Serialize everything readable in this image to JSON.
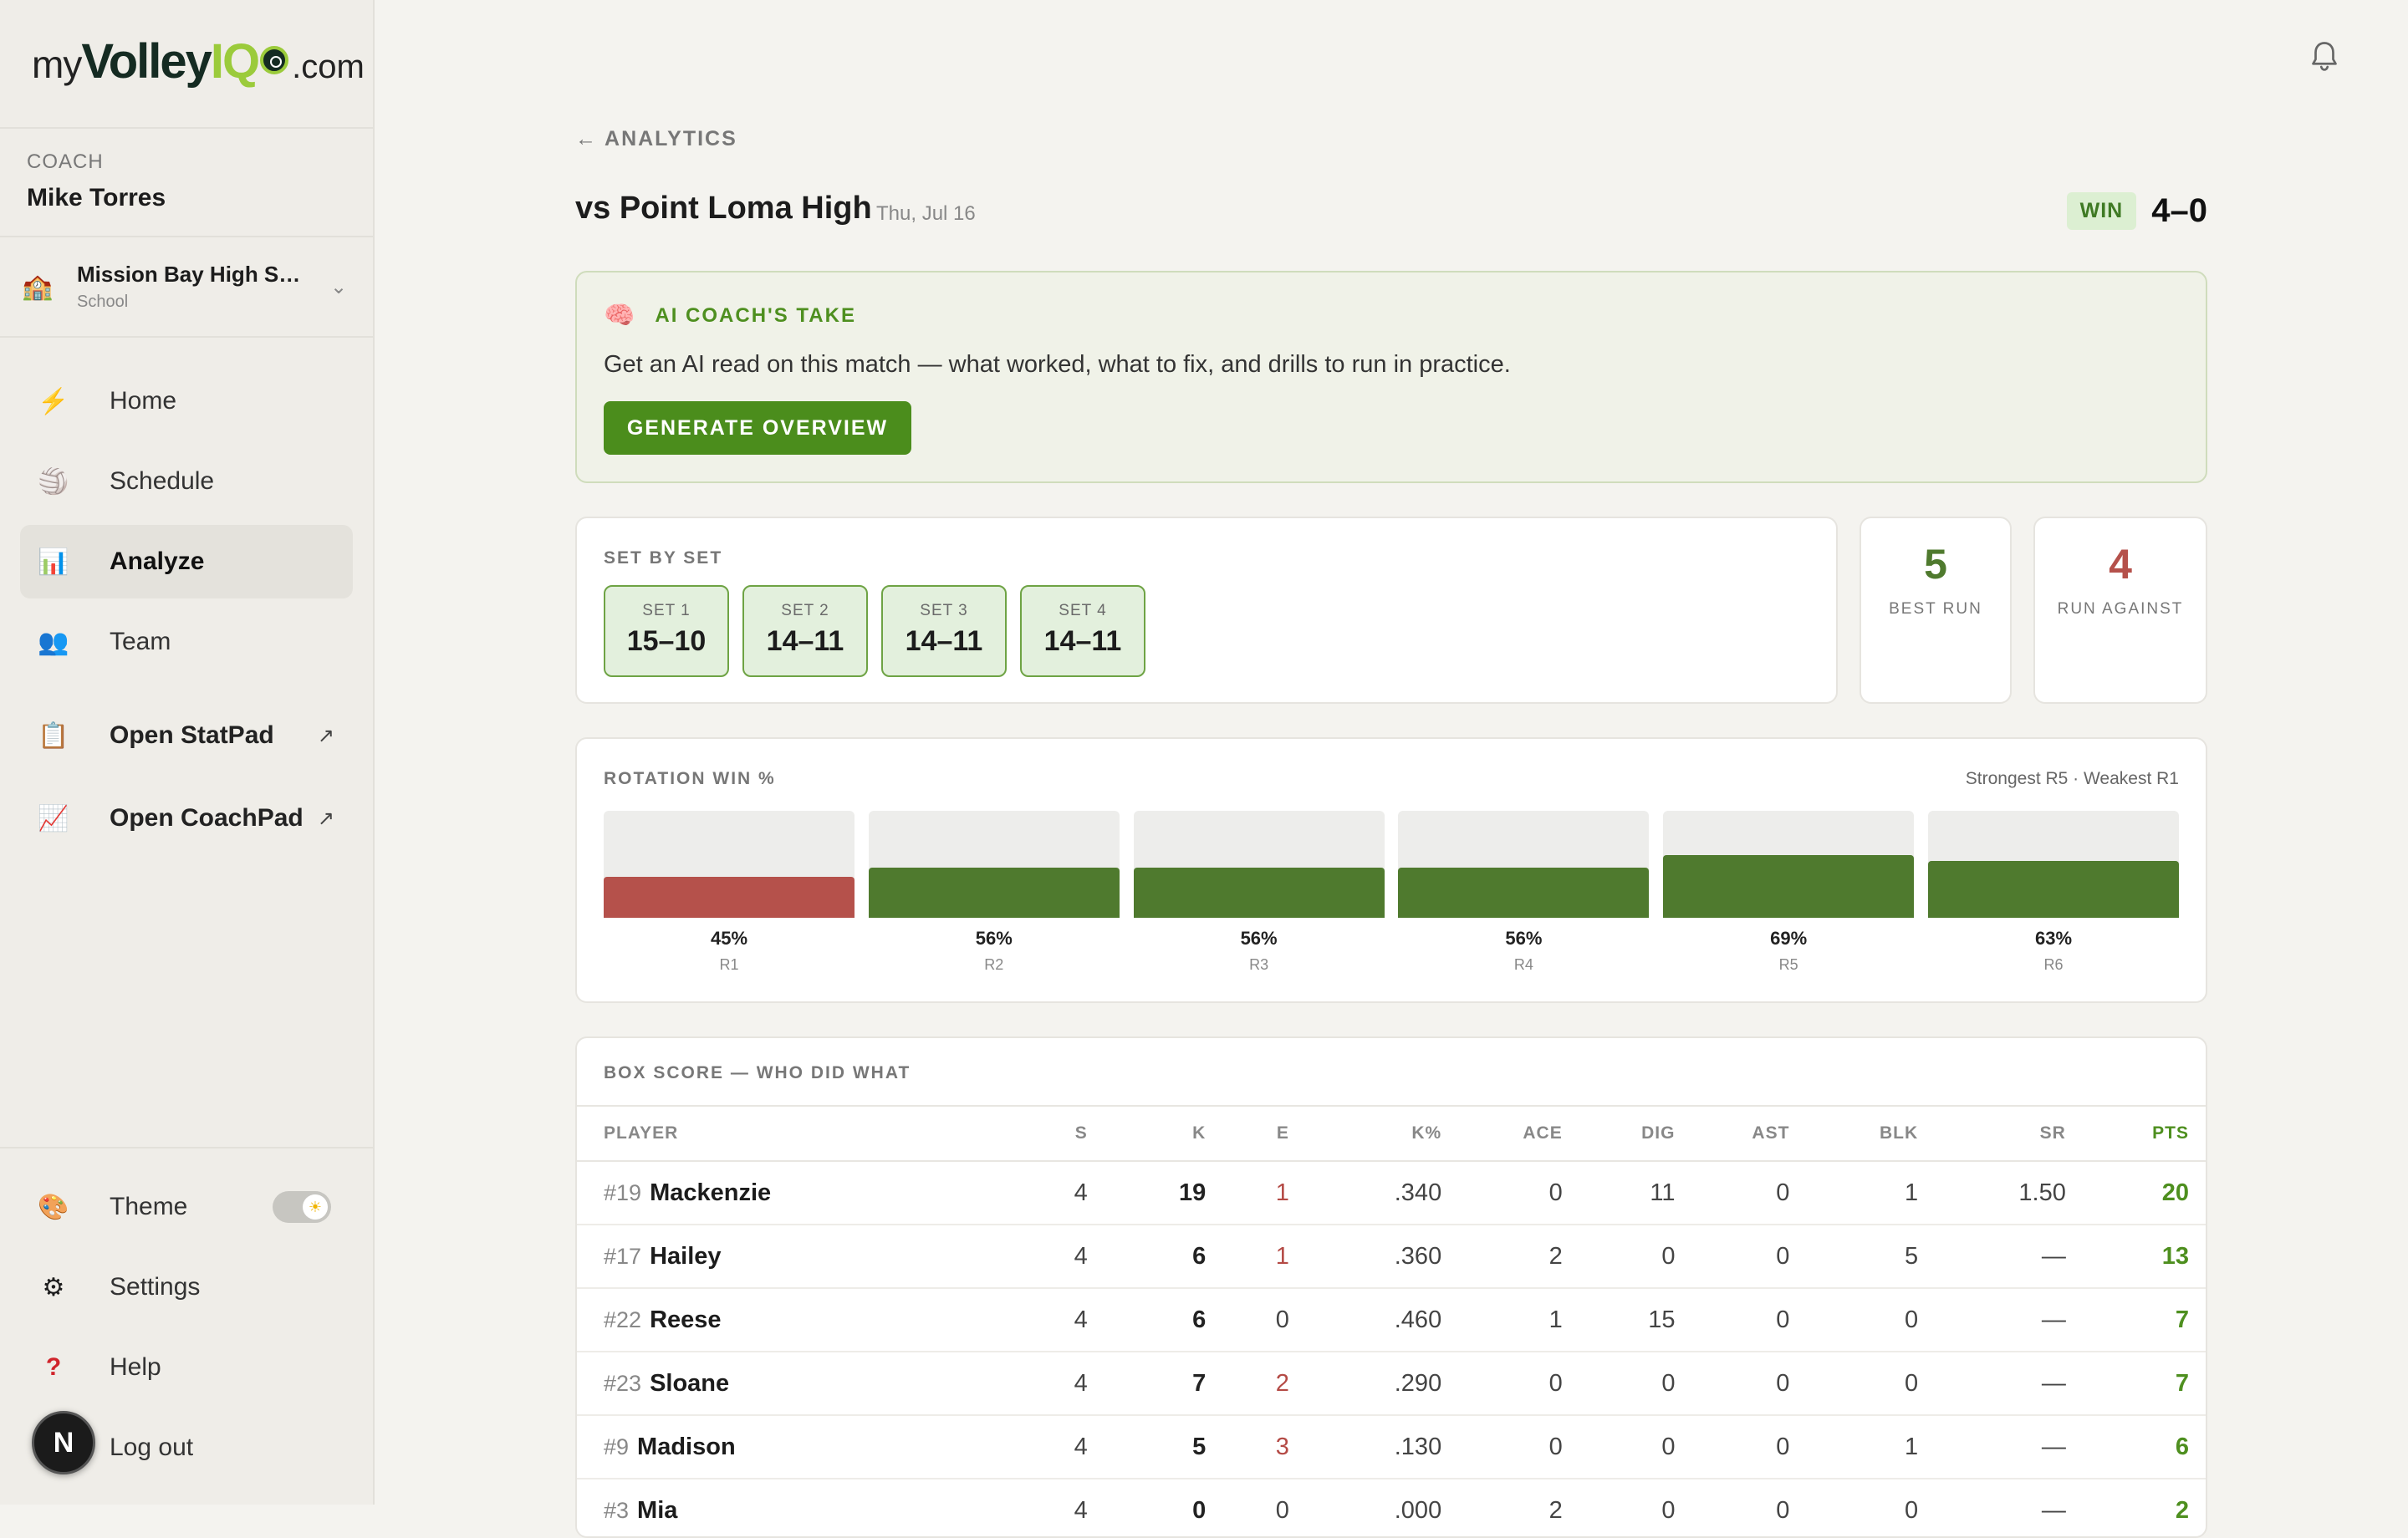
{
  "brand": {
    "my": "my",
    "volley": "Volley",
    "iq": "IQ",
    "com": ".com"
  },
  "coach": {
    "role": "COACH",
    "name": "Mike Torres"
  },
  "school": {
    "name": "Mission Bay High School",
    "type": "School"
  },
  "nav": {
    "home": "Home",
    "schedule": "Schedule",
    "analyze": "Analyze",
    "team": "Team",
    "statpad": "Open StatPad",
    "coachpad": "Open CoachPad",
    "theme": "Theme",
    "settings": "Settings",
    "help": "Help",
    "logout": "Log out"
  },
  "avatar": "N",
  "back_label": "← ANALYTICS",
  "match": {
    "title": "vs Point Loma High",
    "date": "Thu, Jul 16",
    "result": "WIN",
    "score": "4–0"
  },
  "ai": {
    "title": "AI COACH'S TAKE",
    "text": "Get an AI read on this match — what worked, what to fix, and drills to run in practice.",
    "button": "GENERATE OVERVIEW"
  },
  "sets": {
    "label": "SET BY SET",
    "items": [
      {
        "label": "SET 1",
        "score": "15–10"
      },
      {
        "label": "SET 2",
        "score": "14–11"
      },
      {
        "label": "SET 3",
        "score": "14–11"
      },
      {
        "label": "SET 4",
        "score": "14–11"
      }
    ]
  },
  "runs": {
    "best": {
      "value": "5",
      "label": "BEST RUN"
    },
    "against": {
      "value": "4",
      "label": "RUN AGAINST"
    }
  },
  "rotation": {
    "label": "ROTATION WIN %",
    "note": "Strongest R5 · Weakest R1",
    "items": [
      {
        "name": "R1",
        "pct": 45,
        "pct_label": "45%",
        "status": "weak"
      },
      {
        "name": "R2",
        "pct": 56,
        "pct_label": "56%",
        "status": "good"
      },
      {
        "name": "R3",
        "pct": 56,
        "pct_label": "56%",
        "status": "good"
      },
      {
        "name": "R4",
        "pct": 56,
        "pct_label": "56%",
        "status": "good"
      },
      {
        "name": "R5",
        "pct": 69,
        "pct_label": "69%",
        "status": "good"
      },
      {
        "name": "R6",
        "pct": 63,
        "pct_label": "63%",
        "status": "good"
      }
    ]
  },
  "colors": {
    "good": "#4f7a2e",
    "weak": "#b5514b",
    "accent": "#4b8d1c"
  },
  "box": {
    "title": "BOX SCORE — WHO DID WHAT",
    "columns": [
      "PLAYER",
      "S",
      "K",
      "E",
      "K%",
      "ACE",
      "DIG",
      "AST",
      "BLK",
      "SR",
      "PTS"
    ],
    "rows": [
      {
        "num": "#19",
        "name": "Mackenzie",
        "s": "4",
        "k": "19",
        "e": "1",
        "kpct": ".340",
        "ace": "0",
        "dig": "11",
        "ast": "0",
        "blk": "1",
        "sr": "1.50",
        "pts": "20"
      },
      {
        "num": "#17",
        "name": "Hailey",
        "s": "4",
        "k": "6",
        "e": "1",
        "kpct": ".360",
        "ace": "2",
        "dig": "0",
        "ast": "0",
        "blk": "5",
        "sr": "—",
        "pts": "13"
      },
      {
        "num": "#22",
        "name": "Reese",
        "s": "4",
        "k": "6",
        "e": "0",
        "kpct": ".460",
        "ace": "1",
        "dig": "15",
        "ast": "0",
        "blk": "0",
        "sr": "—",
        "pts": "7"
      },
      {
        "num": "#23",
        "name": "Sloane",
        "s": "4",
        "k": "7",
        "e": "2",
        "kpct": ".290",
        "ace": "0",
        "dig": "0",
        "ast": "0",
        "blk": "0",
        "sr": "—",
        "pts": "7"
      },
      {
        "num": "#9",
        "name": "Madison",
        "s": "4",
        "k": "5",
        "e": "3",
        "kpct": ".130",
        "ace": "0",
        "dig": "0",
        "ast": "0",
        "blk": "1",
        "sr": "—",
        "pts": "6"
      },
      {
        "num": "#3",
        "name": "Mia",
        "s": "4",
        "k": "0",
        "e": "0",
        "kpct": ".000",
        "ace": "2",
        "dig": "0",
        "ast": "0",
        "blk": "0",
        "sr": "—",
        "pts": "2"
      }
    ]
  }
}
